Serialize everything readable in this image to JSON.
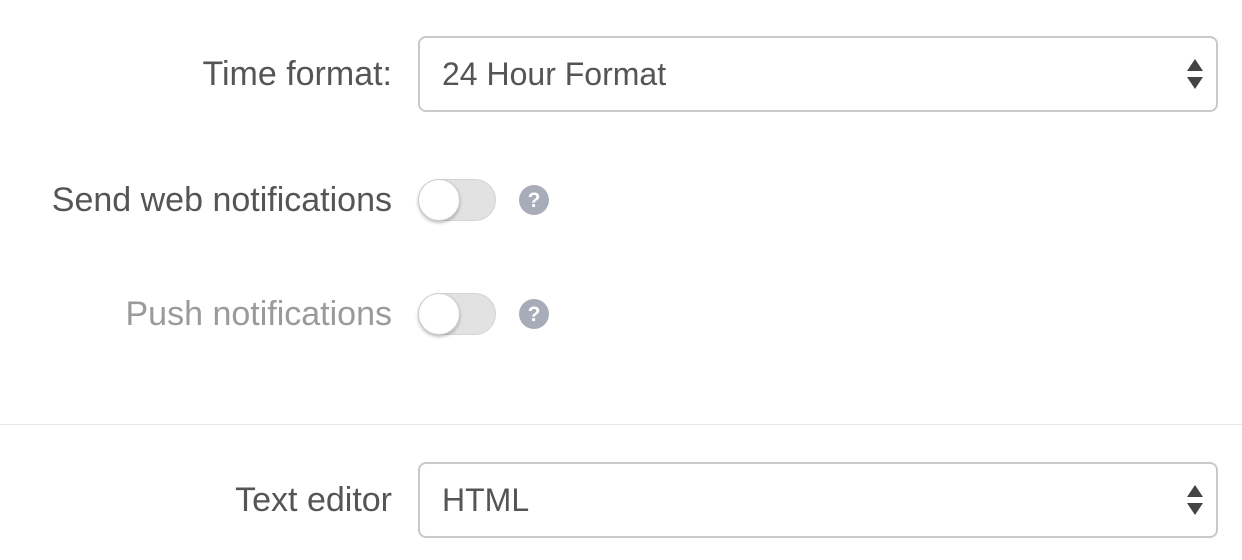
{
  "settings": {
    "time_format": {
      "label": "Time format:",
      "selected": "24 Hour Format"
    },
    "web_notifications": {
      "label": "Send web notifications",
      "enabled": false
    },
    "push_notifications": {
      "label": "Push notifications",
      "enabled": false
    },
    "text_editor": {
      "label": "Text editor",
      "selected": "HTML"
    }
  },
  "colors": {
    "label": "#555555",
    "label_muted": "#9a9a9a",
    "border": "#c9c9c9",
    "toggle_track": "#e2e2e2",
    "help_icon": "#a8acb8"
  }
}
